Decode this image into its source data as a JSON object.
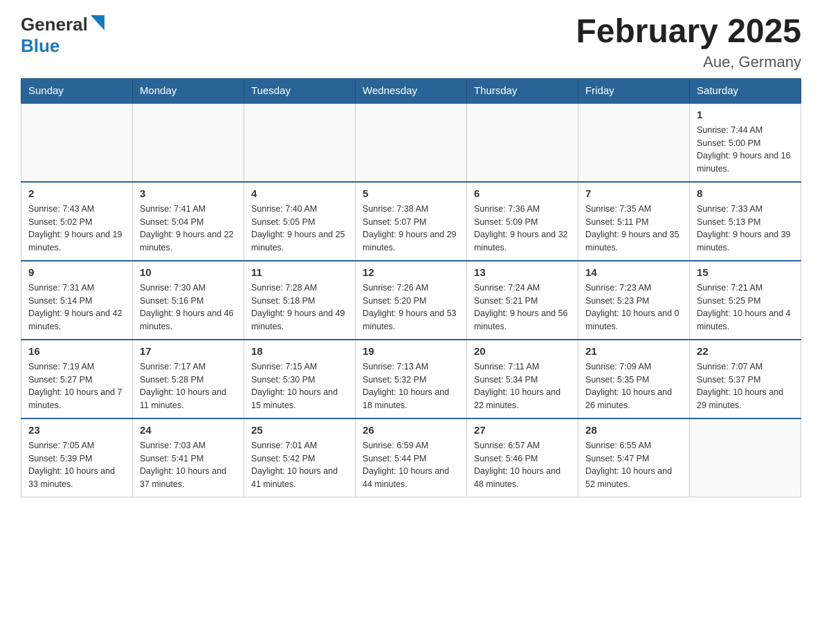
{
  "header": {
    "logo_general": "General",
    "logo_blue": "Blue",
    "month_title": "February 2025",
    "location": "Aue, Germany"
  },
  "weekdays": [
    "Sunday",
    "Monday",
    "Tuesday",
    "Wednesday",
    "Thursday",
    "Friday",
    "Saturday"
  ],
  "weeks": [
    [
      {
        "day": "",
        "sunrise": "",
        "sunset": "",
        "daylight": ""
      },
      {
        "day": "",
        "sunrise": "",
        "sunset": "",
        "daylight": ""
      },
      {
        "day": "",
        "sunrise": "",
        "sunset": "",
        "daylight": ""
      },
      {
        "day": "",
        "sunrise": "",
        "sunset": "",
        "daylight": ""
      },
      {
        "day": "",
        "sunrise": "",
        "sunset": "",
        "daylight": ""
      },
      {
        "day": "",
        "sunrise": "",
        "sunset": "",
        "daylight": ""
      },
      {
        "day": "1",
        "sunrise": "Sunrise: 7:44 AM",
        "sunset": "Sunset: 5:00 PM",
        "daylight": "Daylight: 9 hours and 16 minutes."
      }
    ],
    [
      {
        "day": "2",
        "sunrise": "Sunrise: 7:43 AM",
        "sunset": "Sunset: 5:02 PM",
        "daylight": "Daylight: 9 hours and 19 minutes."
      },
      {
        "day": "3",
        "sunrise": "Sunrise: 7:41 AM",
        "sunset": "Sunset: 5:04 PM",
        "daylight": "Daylight: 9 hours and 22 minutes."
      },
      {
        "day": "4",
        "sunrise": "Sunrise: 7:40 AM",
        "sunset": "Sunset: 5:05 PM",
        "daylight": "Daylight: 9 hours and 25 minutes."
      },
      {
        "day": "5",
        "sunrise": "Sunrise: 7:38 AM",
        "sunset": "Sunset: 5:07 PM",
        "daylight": "Daylight: 9 hours and 29 minutes."
      },
      {
        "day": "6",
        "sunrise": "Sunrise: 7:36 AM",
        "sunset": "Sunset: 5:09 PM",
        "daylight": "Daylight: 9 hours and 32 minutes."
      },
      {
        "day": "7",
        "sunrise": "Sunrise: 7:35 AM",
        "sunset": "Sunset: 5:11 PM",
        "daylight": "Daylight: 9 hours and 35 minutes."
      },
      {
        "day": "8",
        "sunrise": "Sunrise: 7:33 AM",
        "sunset": "Sunset: 5:13 PM",
        "daylight": "Daylight: 9 hours and 39 minutes."
      }
    ],
    [
      {
        "day": "9",
        "sunrise": "Sunrise: 7:31 AM",
        "sunset": "Sunset: 5:14 PM",
        "daylight": "Daylight: 9 hours and 42 minutes."
      },
      {
        "day": "10",
        "sunrise": "Sunrise: 7:30 AM",
        "sunset": "Sunset: 5:16 PM",
        "daylight": "Daylight: 9 hours and 46 minutes."
      },
      {
        "day": "11",
        "sunrise": "Sunrise: 7:28 AM",
        "sunset": "Sunset: 5:18 PM",
        "daylight": "Daylight: 9 hours and 49 minutes."
      },
      {
        "day": "12",
        "sunrise": "Sunrise: 7:26 AM",
        "sunset": "Sunset: 5:20 PM",
        "daylight": "Daylight: 9 hours and 53 minutes."
      },
      {
        "day": "13",
        "sunrise": "Sunrise: 7:24 AM",
        "sunset": "Sunset: 5:21 PM",
        "daylight": "Daylight: 9 hours and 56 minutes."
      },
      {
        "day": "14",
        "sunrise": "Sunrise: 7:23 AM",
        "sunset": "Sunset: 5:23 PM",
        "daylight": "Daylight: 10 hours and 0 minutes."
      },
      {
        "day": "15",
        "sunrise": "Sunrise: 7:21 AM",
        "sunset": "Sunset: 5:25 PM",
        "daylight": "Daylight: 10 hours and 4 minutes."
      }
    ],
    [
      {
        "day": "16",
        "sunrise": "Sunrise: 7:19 AM",
        "sunset": "Sunset: 5:27 PM",
        "daylight": "Daylight: 10 hours and 7 minutes."
      },
      {
        "day": "17",
        "sunrise": "Sunrise: 7:17 AM",
        "sunset": "Sunset: 5:28 PM",
        "daylight": "Daylight: 10 hours and 11 minutes."
      },
      {
        "day": "18",
        "sunrise": "Sunrise: 7:15 AM",
        "sunset": "Sunset: 5:30 PM",
        "daylight": "Daylight: 10 hours and 15 minutes."
      },
      {
        "day": "19",
        "sunrise": "Sunrise: 7:13 AM",
        "sunset": "Sunset: 5:32 PM",
        "daylight": "Daylight: 10 hours and 18 minutes."
      },
      {
        "day": "20",
        "sunrise": "Sunrise: 7:11 AM",
        "sunset": "Sunset: 5:34 PM",
        "daylight": "Daylight: 10 hours and 22 minutes."
      },
      {
        "day": "21",
        "sunrise": "Sunrise: 7:09 AM",
        "sunset": "Sunset: 5:35 PM",
        "daylight": "Daylight: 10 hours and 26 minutes."
      },
      {
        "day": "22",
        "sunrise": "Sunrise: 7:07 AM",
        "sunset": "Sunset: 5:37 PM",
        "daylight": "Daylight: 10 hours and 29 minutes."
      }
    ],
    [
      {
        "day": "23",
        "sunrise": "Sunrise: 7:05 AM",
        "sunset": "Sunset: 5:39 PM",
        "daylight": "Daylight: 10 hours and 33 minutes."
      },
      {
        "day": "24",
        "sunrise": "Sunrise: 7:03 AM",
        "sunset": "Sunset: 5:41 PM",
        "daylight": "Daylight: 10 hours and 37 minutes."
      },
      {
        "day": "25",
        "sunrise": "Sunrise: 7:01 AM",
        "sunset": "Sunset: 5:42 PM",
        "daylight": "Daylight: 10 hours and 41 minutes."
      },
      {
        "day": "26",
        "sunrise": "Sunrise: 6:59 AM",
        "sunset": "Sunset: 5:44 PM",
        "daylight": "Daylight: 10 hours and 44 minutes."
      },
      {
        "day": "27",
        "sunrise": "Sunrise: 6:57 AM",
        "sunset": "Sunset: 5:46 PM",
        "daylight": "Daylight: 10 hours and 48 minutes."
      },
      {
        "day": "28",
        "sunrise": "Sunrise: 6:55 AM",
        "sunset": "Sunset: 5:47 PM",
        "daylight": "Daylight: 10 hours and 52 minutes."
      },
      {
        "day": "",
        "sunrise": "",
        "sunset": "",
        "daylight": ""
      }
    ]
  ]
}
